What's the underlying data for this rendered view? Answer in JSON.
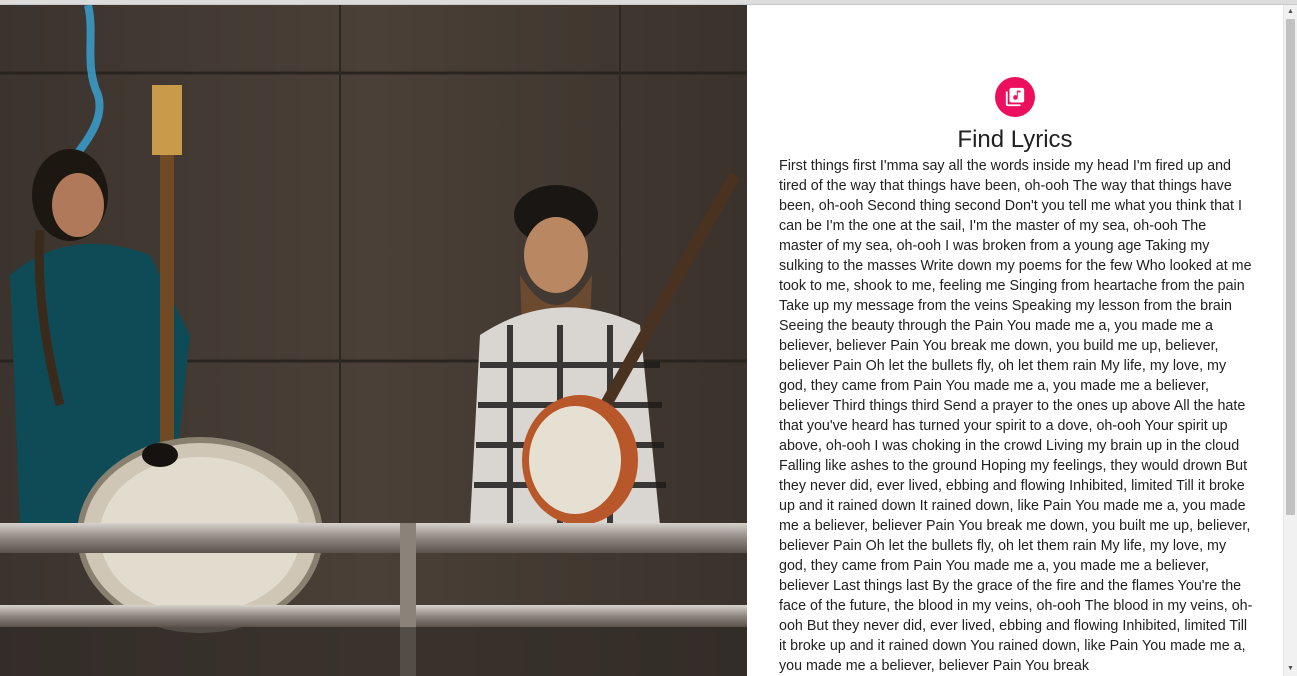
{
  "header": {
    "title": "Find Lyrics",
    "icon": "music-library-icon",
    "accent_color": "#ec0f5e"
  },
  "hero_image": {
    "description_icon": "musicians-photo"
  },
  "lyrics": {
    "text": "First things first I'mma say all the words inside my head I'm fired up and tired of the way that things have been, oh-ooh The way that things have been, oh-ooh Second thing second Don't you tell me what you think that I can be I'm the one at the sail, I'm the master of my sea, oh-ooh The master of my sea, oh-ooh I was broken from a young age Taking my sulking to the masses Write down my poems for the few Who looked at me took to me, shook to me, feeling me Singing from heartache from the pain Take up my message from the veins Speaking my lesson from the brain Seeing the beauty through the Pain You made me a, you made me a believer, believer Pain You break me down, you build me up, believer, believer Pain Oh let the bullets fly, oh let them rain My life, my love, my god, they came from Pain You made me a, you made me a believer, believer Third things third Send a prayer to the ones up above All the hate that you've heard has turned your spirit to a dove, oh-ooh Your spirit up above, oh-ooh I was choking in the crowd Living my brain up in the cloud Falling like ashes to the ground Hoping my feelings, they would drown But they never did, ever lived, ebbing and flowing Inhibited, limited Till it broke up and it rained down It rained down, like Pain You made me a, you made me a believer, believer Pain You break me down, you built me up, believer, believer Pain Oh let the bullets fly, oh let them rain My life, my love, my god, they came from Pain You made me a, you made me a believer, believer Last things last By the grace of the fire and the flames You're the face of the future, the blood in my veins, oh-ooh The blood in my veins, oh-ooh But they never did, ever lived, ebbing and flowing Inhibited, limited Till it broke up and it rained down You rained down, like Pain You made me a, you made me a believer, believer Pain You break"
  },
  "scrollbar": {
    "up_glyph": "▲",
    "down_glyph": "▼"
  }
}
